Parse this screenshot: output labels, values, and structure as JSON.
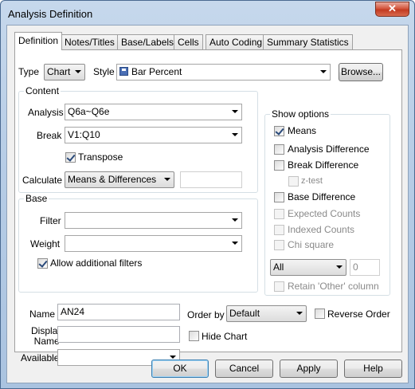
{
  "window": {
    "title": "Analysis Definition",
    "close_glyph": "✕"
  },
  "tabs": [
    {
      "label": "Definition",
      "active": true
    },
    {
      "label": "Notes/Titles"
    },
    {
      "label": "Base/Labels"
    },
    {
      "label": "Cells"
    },
    {
      "label": "Auto Coding"
    },
    {
      "label": "Summary Statistics"
    }
  ],
  "top": {
    "type_label": "Type",
    "type_value": "Chart",
    "style_label": "Style",
    "style_value": "Bar Percent",
    "browse_label": "Browse..."
  },
  "content": {
    "title": "Content",
    "analysis_label": "Analysis",
    "analysis_value": "Q6a~Q6e",
    "break_label": "Break",
    "break_value": "V1:Q10",
    "transpose_label": "Transpose",
    "calculate_label": "Calculate",
    "calculate_value": "Means & Differences",
    "calculate_extra": ""
  },
  "base": {
    "title": "Base",
    "filter_label": "Filter",
    "filter_value": "",
    "weight_label": "Weight",
    "weight_value": "",
    "allow_filters_label": "Allow additional filters"
  },
  "show_options": {
    "title": "Show options",
    "means": "Means",
    "analysis_difference": "Analysis Difference",
    "break_difference": "Break Difference",
    "z_test": "z-test",
    "base_difference": "Base Difference",
    "expected_counts": "Expected Counts",
    "indexed_counts": "Indexed Counts",
    "chi_square": "Chi square",
    "all_value": "All",
    "number_value": "0",
    "retain_other": "Retain 'Other' column"
  },
  "bottom": {
    "name_label": "Name",
    "name_value": "AN24",
    "display_name_label": "Display\nName",
    "display_name_value": "",
    "available_label": "Available",
    "available_value": "",
    "order_by_label": "Order by",
    "order_by_value": "Default",
    "reverse_order_label": "Reverse Order",
    "hide_chart_label": "Hide Chart"
  },
  "buttons": {
    "ok": "OK",
    "cancel": "Cancel",
    "apply": "Apply",
    "help": "Help"
  },
  "colors": {
    "accent_border": "#3c7fb1",
    "title_bg": "#b7cde6",
    "close_red": "#c23b21"
  }
}
